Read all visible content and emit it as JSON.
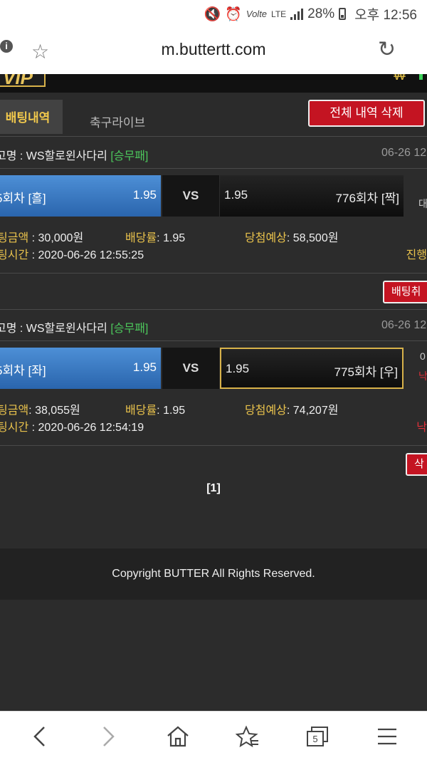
{
  "status_bar": {
    "battery": "28%",
    "time": "오후 12:56",
    "volte": "Volte",
    "lte": "LTE"
  },
  "browser": {
    "url": "m.buttertt.com"
  },
  "site": {
    "vip": "VIP",
    "tabs": {
      "bet_history": "배팅내역",
      "soccer_live": "축구라이브"
    },
    "delete_all": "전체 내역 삭제",
    "bets": [
      {
        "game": "고명 : WS할로윈사다리",
        "result": "[승무패]",
        "date": "06-26 12",
        "home_label": "5회차 [홀]",
        "home_odds": "1.95",
        "vs": "VS",
        "away_odds": "1.95",
        "away_label": "776회차 [짝]",
        "side_text": "대",
        "amount_label": "팅금액",
        "amount": "30,000원",
        "odds_label": "배당률",
        "odds": "1.95",
        "expected_label": "당첨예상",
        "expected": "58,500원",
        "time_label": "팅시간",
        "time": "2020-06-26 12:55:25",
        "status": "진행",
        "action": "배팅취"
      },
      {
        "game": "고명 : WS할로윈사다리",
        "result": "[승무패]",
        "date": "06-26 12",
        "home_label": "5회차 [좌]",
        "home_odds": "1.95",
        "vs": "VS",
        "away_odds": "1.95",
        "away_label": "775회차 [우]",
        "side_top": "0",
        "side_bottom": "낙",
        "amount_label": "팅금액",
        "amount": "38,055원",
        "odds_label": "배당률",
        "odds": "1.95",
        "expected_label": "당첨예상",
        "expected": "74,207원",
        "time_label": "팅시간",
        "time": "2020-06-26 12:54:19",
        "status": "낙",
        "action": "삭"
      }
    ],
    "pager": "[1]",
    "footer": "Copyright BUTTER All Rights Reserved."
  },
  "nav": {
    "tabs_count": "5"
  }
}
